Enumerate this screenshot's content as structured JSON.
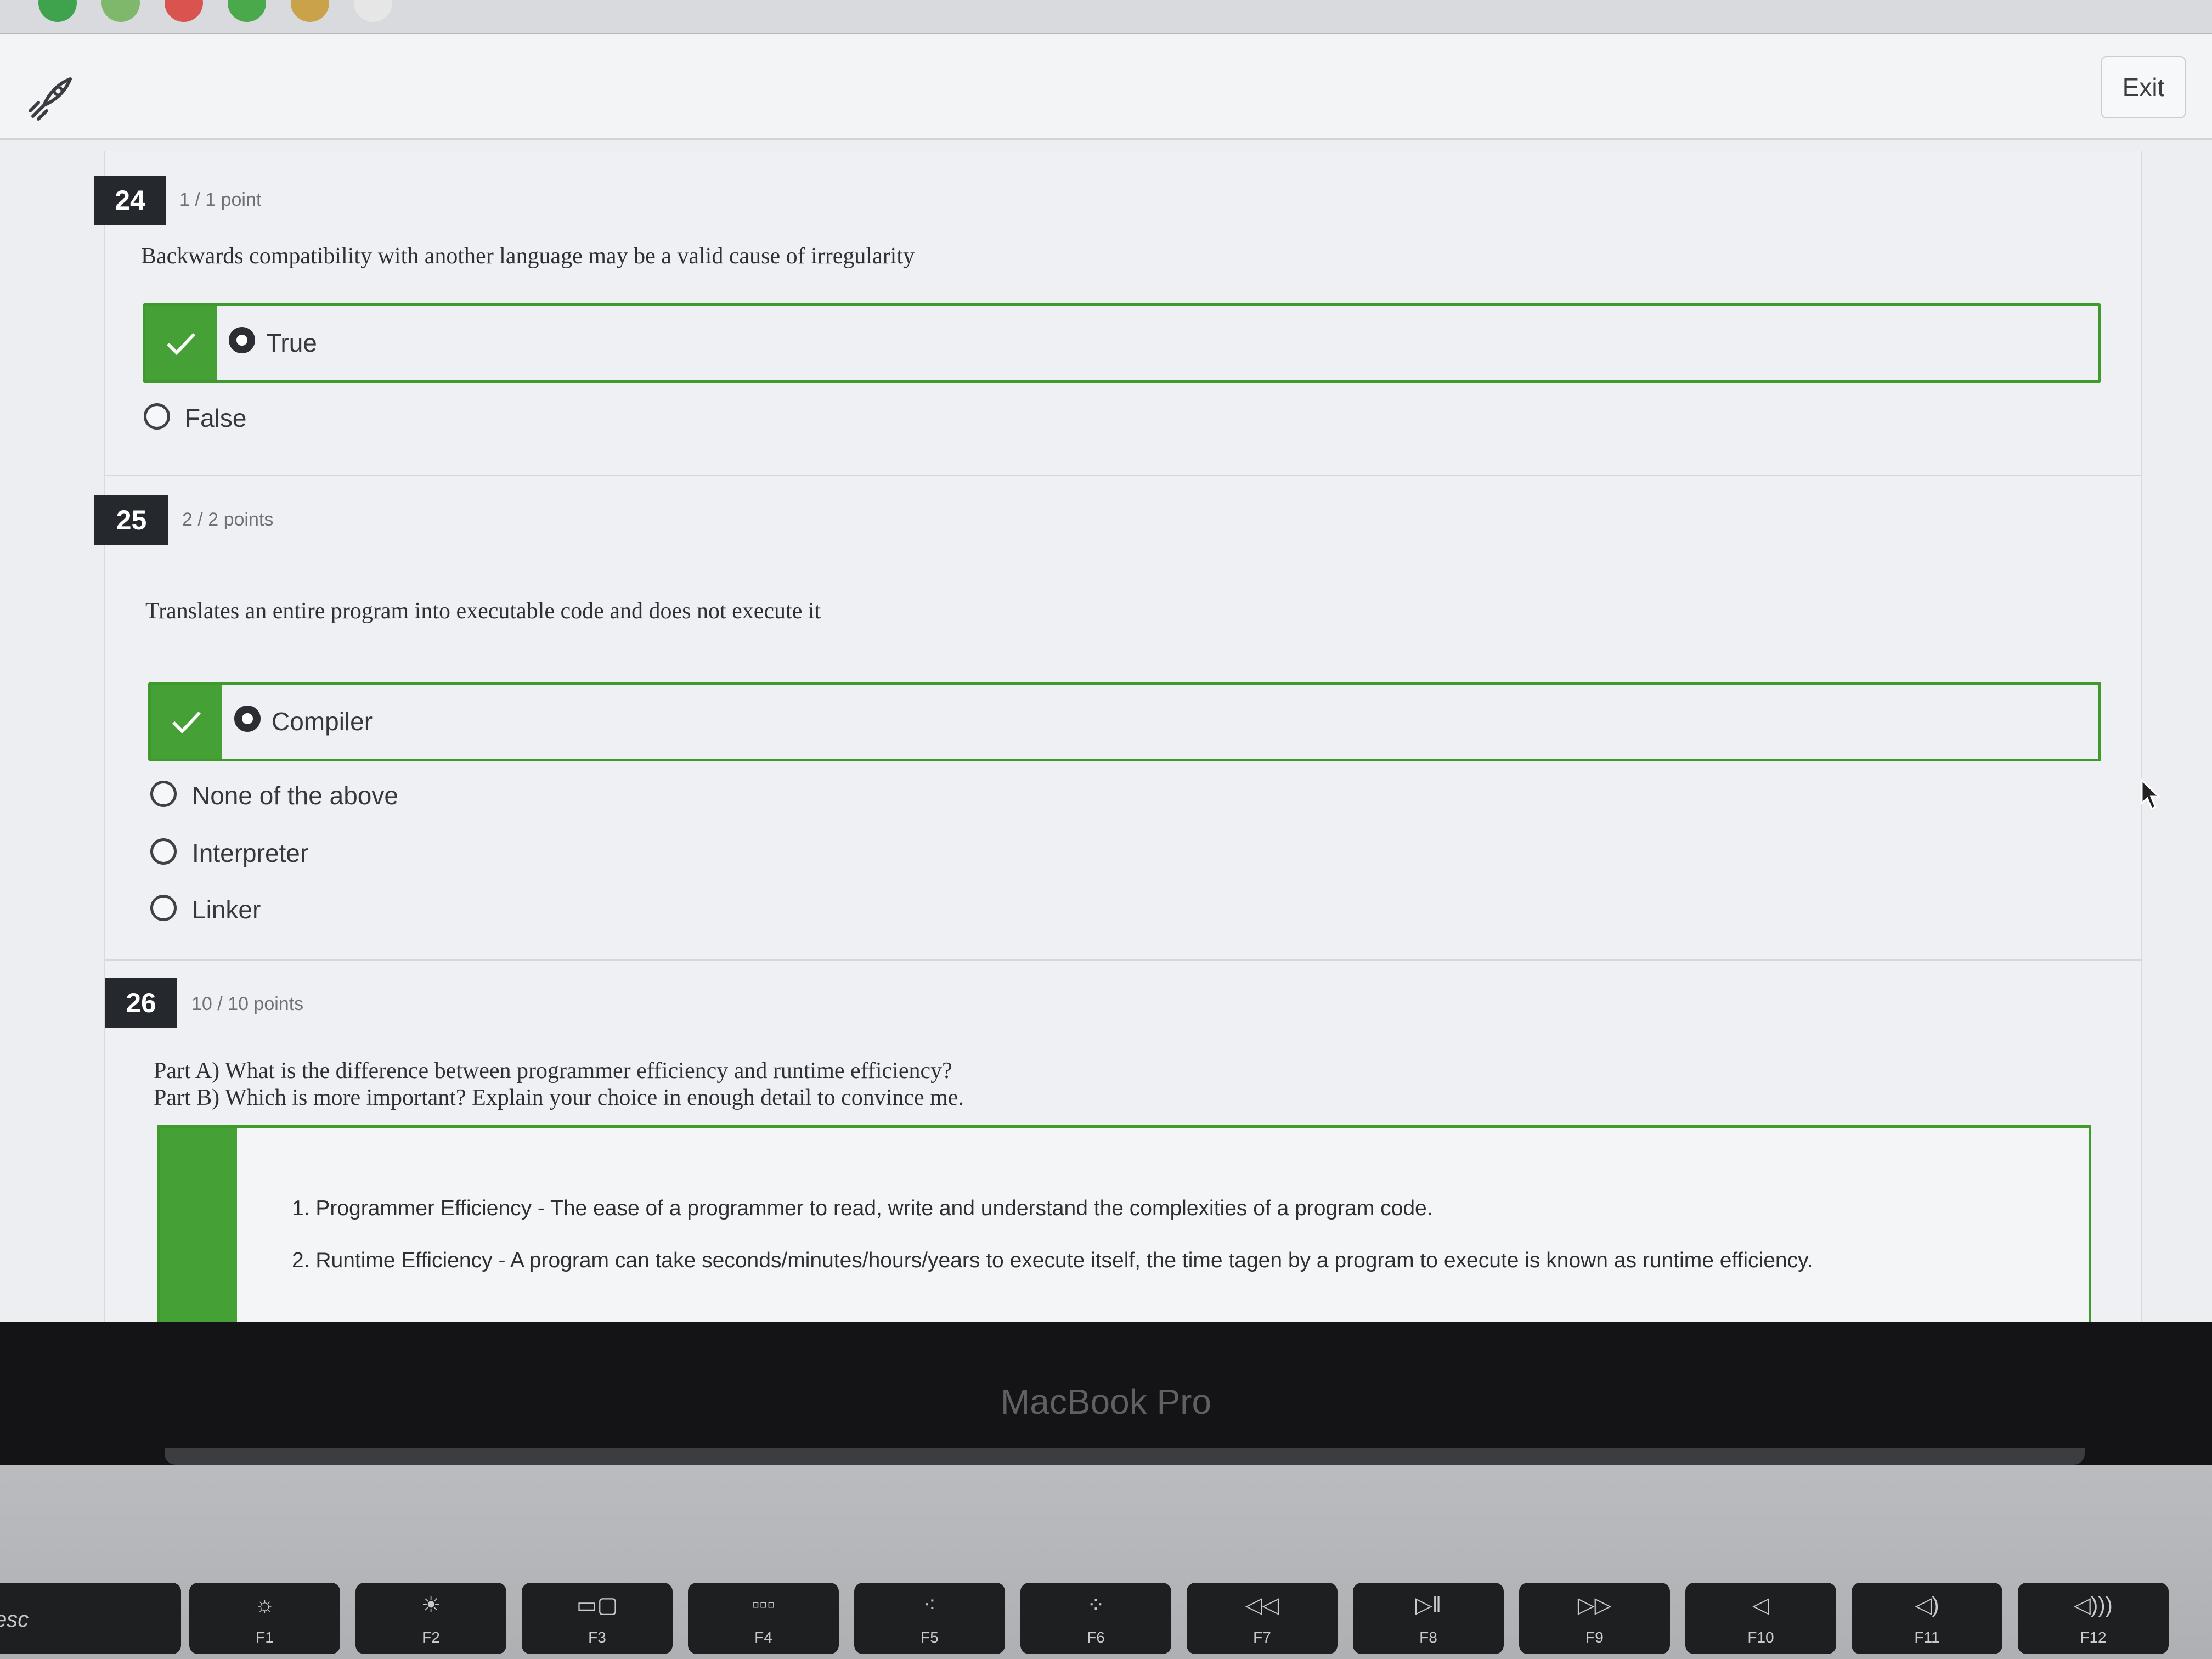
{
  "header": {
    "exit_label": "Exit"
  },
  "questions": [
    {
      "number": "24",
      "points": "1 / 1 point",
      "text": "Backwards compatibility with another language may be a valid cause of irregularity",
      "options": [
        "True",
        "False"
      ],
      "selected": "True"
    },
    {
      "number": "25",
      "points": "2 / 2 points",
      "text": "Translates an entire program into executable code and does not execute it",
      "options": [
        "Compiler",
        "None of the above",
        "Interpreter",
        "Linker"
      ],
      "selected": "Compiler"
    },
    {
      "number": "26",
      "points": "10 / 10 points",
      "text_a": "Part A) What is the difference between programmer efficiency and runtime efficiency?",
      "text_b": "Part B) Which is more important? Explain your choice in enough detail to convince me.",
      "answer_lines": [
        "1. Programmer Efficiency - The ease of a programmer to read, write and understand the complexities of a program code.",
        "2. Runtime Efficiency - A program can take seconds/minutes/hours/years to execute itself, the time tagen by a program to execute is known as runtime efficiency."
      ]
    }
  ],
  "bezel": {
    "label": "MacBook Pro"
  },
  "keyboard": {
    "esc": "esc",
    "keys": [
      {
        "label": "F1",
        "icon": "brightness-down-icon",
        "glyph": "☼"
      },
      {
        "label": "F2",
        "icon": "brightness-up-icon",
        "glyph": "☀"
      },
      {
        "label": "F3",
        "icon": "mission-control-icon",
        "glyph": "▭▢"
      },
      {
        "label": "F4",
        "icon": "launchpad-icon",
        "glyph": "▫▫▫"
      },
      {
        "label": "F5",
        "icon": "keyboard-light-down-icon",
        "glyph": "⁖"
      },
      {
        "label": "F6",
        "icon": "keyboard-light-up-icon",
        "glyph": "⁘"
      },
      {
        "label": "F7",
        "icon": "rewind-icon",
        "glyph": "◁◁"
      },
      {
        "label": "F8",
        "icon": "play-pause-icon",
        "glyph": "▷‖"
      },
      {
        "label": "F9",
        "icon": "fast-forward-icon",
        "glyph": "▷▷"
      },
      {
        "label": "F10",
        "icon": "mute-icon",
        "glyph": "◁"
      },
      {
        "label": "F11",
        "icon": "volume-down-icon",
        "glyph": "◁)"
      },
      {
        "label": "F12",
        "icon": "volume-up-icon",
        "glyph": "◁)))"
      }
    ]
  }
}
